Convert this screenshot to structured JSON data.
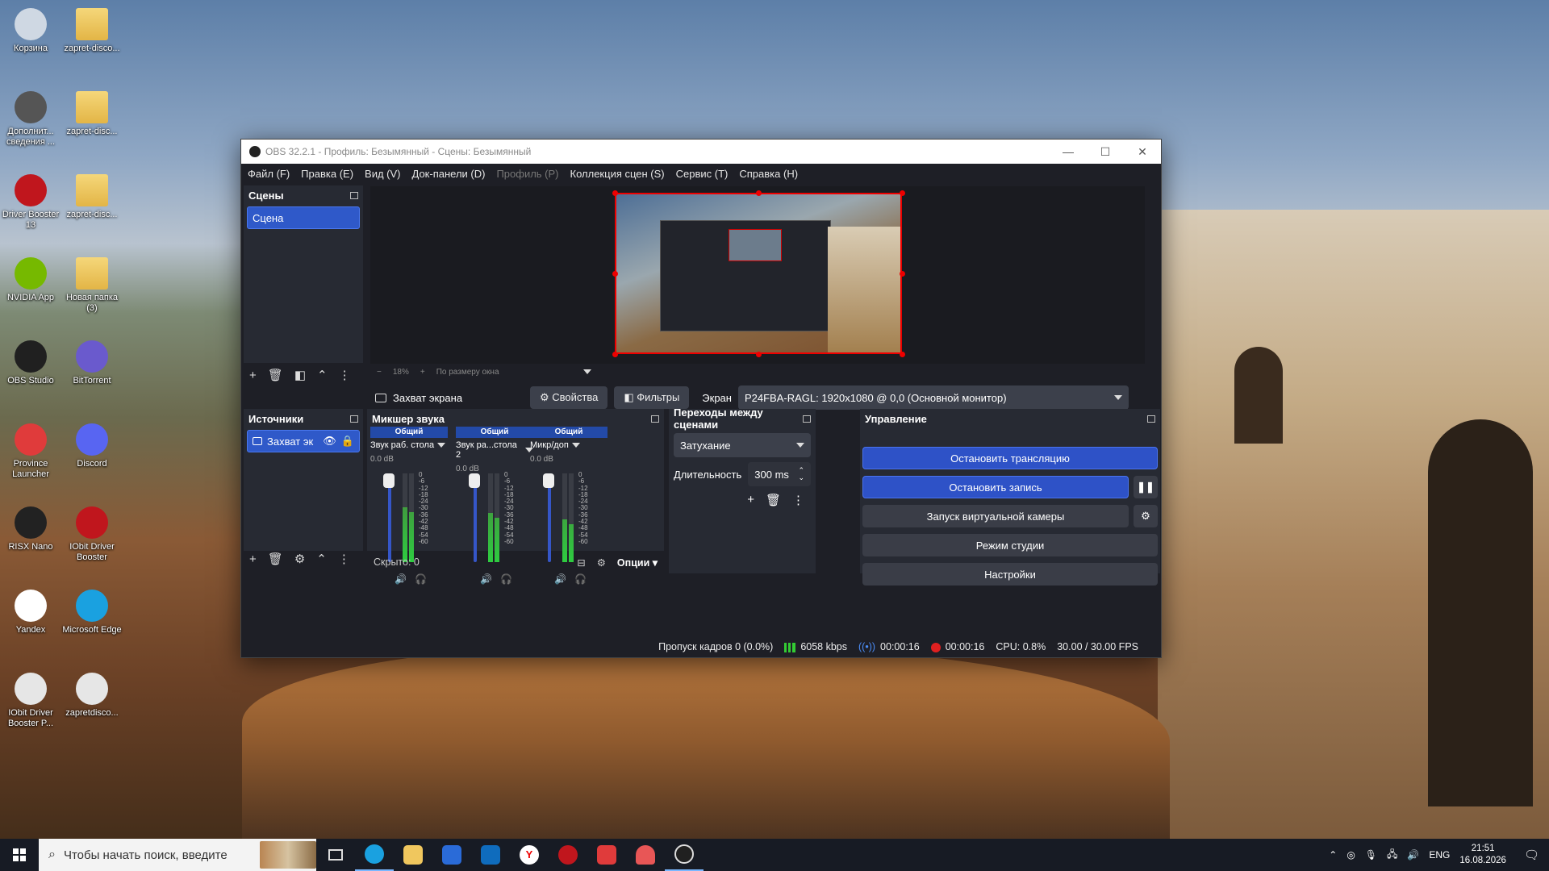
{
  "desktop": {
    "icons": [
      {
        "label": "Корзина",
        "icon": "recycle-bin-icon",
        "color": "#cfd8e3"
      },
      {
        "label": "zapret-disco...",
        "icon": "folder-icon",
        "color": "#f0c75e"
      },
      {
        "label": "Дополнит... сведения ...",
        "icon": "settings-icon",
        "color": "#555"
      },
      {
        "label": "zapret-disc...",
        "icon": "folder-icon",
        "color": "#f0c75e"
      },
      {
        "label": "Driver Booster 13",
        "icon": "driver-booster-icon",
        "color": "#c0161d"
      },
      {
        "label": "zapret-disc...",
        "icon": "folder-icon",
        "color": "#f0c75e"
      },
      {
        "label": "NVIDIA App",
        "icon": "nvidia-icon",
        "color": "#76b900"
      },
      {
        "label": "Новая папка (3)",
        "icon": "folder-icon",
        "color": "#f0c75e"
      },
      {
        "label": "OBS Studio",
        "icon": "obs-icon",
        "color": "#202020"
      },
      {
        "label": "BitTorrent",
        "icon": "bittorrent-icon",
        "color": "#6a5acd"
      },
      {
        "label": "Province Launcher",
        "icon": "launcher-icon",
        "color": "#e03b3b"
      },
      {
        "label": "Discord",
        "icon": "discord-icon",
        "color": "#5865f2"
      },
      {
        "label": "RISX Nano",
        "icon": "risx-icon",
        "color": "#222"
      },
      {
        "label": "IObit Driver Booster",
        "icon": "driver-booster-icon",
        "color": "#c0161d"
      },
      {
        "label": "Yandex",
        "icon": "yandex-icon",
        "color": "#ffffff"
      },
      {
        "label": "Microsoft Edge",
        "icon": "edge-icon",
        "color": "#1aa1e0"
      },
      {
        "label": "IObit Driver Booster P...",
        "icon": "file-icon",
        "color": "#e6e6e6"
      },
      {
        "label": "zapretdisco...",
        "icon": "file-icon",
        "color": "#e6e6e6"
      }
    ]
  },
  "window": {
    "title": "OBS 32.2.1 - Профиль: Безымянный - Сцены: Безымянный",
    "menu": [
      "Файл (F)",
      "Правка (E)",
      "Вид (V)",
      "Док-панели (D)",
      "Профиль (P)",
      "Коллекция сцен (S)",
      "Сервис (T)",
      "Справка (H)"
    ]
  },
  "scenes": {
    "title": "Сцены",
    "items": [
      "Сцена"
    ]
  },
  "sources": {
    "title": "Источники",
    "items": [
      "Захват эк"
    ]
  },
  "preview": {
    "zoom": "18%",
    "fit_label": "По размеру окна"
  },
  "source_bar": {
    "source_name": "Захват экрана",
    "properties": "Свойства",
    "filters": "Фильтры",
    "screen_label": "Экран",
    "screen_value": "P24FBA-RAGL: 1920x1080 @ 0,0 (Основной монитор)"
  },
  "mixer": {
    "title": "Микшер звука",
    "channels": [
      {
        "head": "Общий",
        "name": "Звук раб. стола",
        "db": "0.0 dB",
        "level": 0.62
      },
      {
        "head": "Общий",
        "name": "Звук ра...стола 2",
        "db": "0.0 dB",
        "level": 0.55
      },
      {
        "head": "Общий",
        "name": "Микр/доп",
        "db": "0.0 dB",
        "level": 0.48
      }
    ],
    "ticks": [
      "0",
      "-6",
      "-12",
      "-18",
      "-24",
      "-30",
      "-36",
      "-42",
      "-48",
      "-54",
      "-60"
    ],
    "hidden": "Скрыто: 0",
    "options": "Опции"
  },
  "transitions": {
    "title": "Переходы между сценами",
    "type": "Затухание",
    "duration_label": "Длительность",
    "duration_value": "300 ms"
  },
  "controls": {
    "title": "Управление",
    "stop_stream": "Остановить трансляцию",
    "stop_record": "Остановить запись",
    "virtual_cam": "Запуск виртуальной камеры",
    "studio_mode": "Режим студии",
    "settings": "Настройки"
  },
  "status": {
    "dropped": "Пропуск кадров 0 (0.0%)",
    "bitrate": "6058 kbps",
    "stream_time": "00:00:16",
    "rec_time": "00:00:16",
    "cpu": "CPU: 0.8%",
    "fps": "30.00 / 30.00 FPS"
  },
  "taskbar": {
    "search_placeholder": "Чтобы начать поиск, введите",
    "lang": "ENG",
    "time": "21:51",
    "date": "16.08.2026"
  }
}
